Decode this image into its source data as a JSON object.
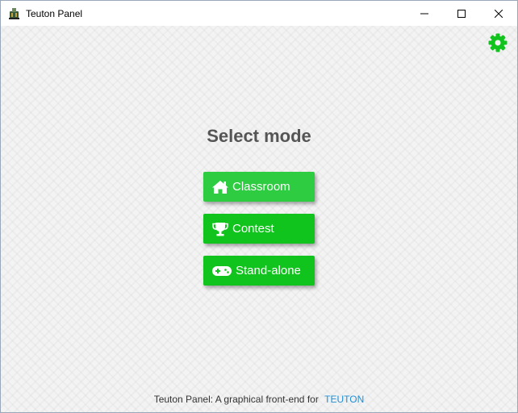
{
  "window": {
    "title": "Teuton Panel",
    "minimize_icon": "minimize-icon",
    "maximize_icon": "maximize-icon",
    "close_icon": "close-icon",
    "app_icon": "teuton-app-icon"
  },
  "header": {
    "settings_icon": "gear-icon",
    "accent_color": "#11c41d"
  },
  "main": {
    "title": "Select mode",
    "modes": [
      {
        "label": "Classroom",
        "icon": "home-icon",
        "color": "#2ecc40"
      },
      {
        "label": "Contest",
        "icon": "trophy-icon",
        "color": "#11c41d"
      },
      {
        "label": "Stand-alone",
        "icon": "gamepad-icon",
        "color": "#11c41d"
      }
    ]
  },
  "footer": {
    "text": "Teuton Panel: A graphical front-end for",
    "link_label": "TEUTON",
    "link_color": "#1e8fd6"
  }
}
